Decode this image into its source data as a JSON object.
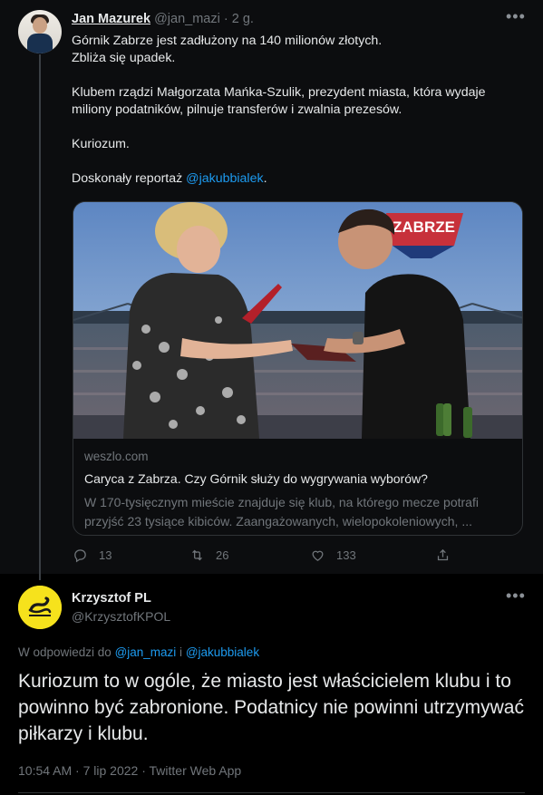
{
  "parent_tweet": {
    "author_name": "Jan Mazurek",
    "author_handle": "@jan_mazi",
    "separator": "·",
    "time": "2 g.",
    "body_lines": [
      "Górnik Zabrze jest zadłużony na 140 milionów złotych.",
      "Zbliża się upadek.",
      "Klubem rządzi Małgorzata Mańka-Szulik, prezydent miasta, która wydaje miliony podatników, pilnuje transferów i zwalnia prezesów.",
      "Kuriozum.",
      "Doskonały reportaż "
    ],
    "body_mention": "@jakubbialek",
    "body_end": ".",
    "card": {
      "image_sign_text": "ZABRZE",
      "domain": "weszlo.com",
      "title": "Caryca z Zabrza. Czy Górnik służy do wygrywania wyborów?",
      "description": "W 170-tysięcznym mieście znajduje się klub, na którego mecze potrafi przyjść 23 tysiące kibiców. Zaangażowanych, wielopokoleniowych, ..."
    },
    "actions": {
      "replies": "13",
      "retweets": "26",
      "likes": "133"
    }
  },
  "reply_tweet": {
    "author_name": "Krzysztof PL",
    "author_handle": "@KrzysztofKPOL",
    "replying_prefix": "W odpowiedzi do ",
    "replying_mention_1": "@jan_mazi",
    "replying_joiner": " i ",
    "replying_mention_2": "@jakubbialek",
    "text": "Kuriozum to w ogóle, że miasto jest właścicielem klubu i to powinno być zabronione. Podatnicy nie powinni utrzymywać piłkarzy i klubu.",
    "meta": "10:54 AM · 7 lip 2022 · Twitter Web App"
  },
  "icons": {
    "reply": "reply-icon",
    "retweet": "retweet-icon",
    "like": "heart-icon",
    "share": "share-icon",
    "more": "more-horizontal-icon"
  },
  "colors": {
    "background": "#000000",
    "parent_background": "#0c0d0f",
    "text": "#e7e9ea",
    "muted": "#71767b",
    "link": "#1d9bf0",
    "border": "#2f3336"
  }
}
